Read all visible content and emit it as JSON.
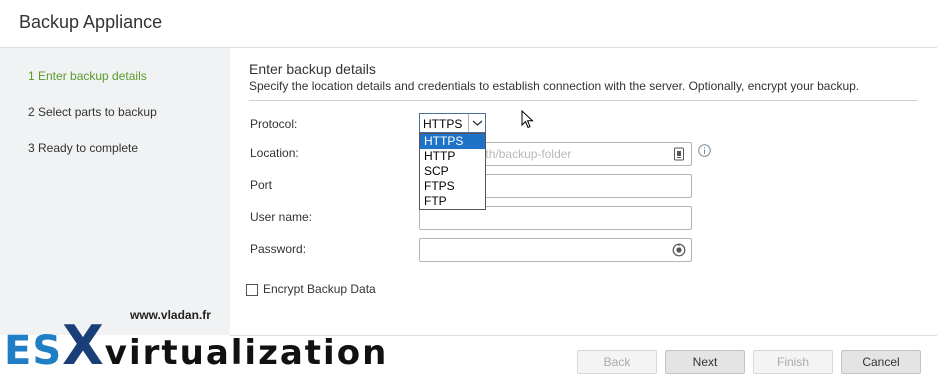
{
  "window": {
    "title": "Backup Appliance"
  },
  "sidebar": {
    "steps": [
      {
        "label": "1 Enter backup details",
        "active": true
      },
      {
        "label": "2 Select parts to backup",
        "active": false
      },
      {
        "label": "3 Ready to complete",
        "active": false
      }
    ]
  },
  "main": {
    "heading": "Enter backup details",
    "subheading": "Specify the location details and credentials to establish connection with the server. Optionally, encrypt your backup.",
    "protocol": {
      "label": "Protocol:",
      "selected": "HTTPS",
      "options": [
        "HTTPS",
        "HTTP",
        "SCP",
        "FTPS",
        "FTP"
      ]
    },
    "location": {
      "label": "Location:",
      "placeholder": "address/path/backup-folder",
      "value": ""
    },
    "port": {
      "label": "Port",
      "value": ""
    },
    "username": {
      "label": "User name:",
      "value": ""
    },
    "password": {
      "label": "Password:",
      "value": ""
    },
    "encrypt": {
      "label": "Encrypt Backup Data",
      "checked": false
    }
  },
  "footer": {
    "back": "Back",
    "next": "Next",
    "finish": "Finish",
    "cancel": "Cancel"
  },
  "watermark": {
    "url": "www.vladan.fr",
    "brand_es": "ES",
    "brand_x": "X",
    "brand_rest": "virtualization"
  },
  "colors": {
    "active_step": "#5a9a2b",
    "selected_option": "#1e73c9",
    "sidebar_bg": "#f0f2f3",
    "brand_blue": "#1f7ec4"
  }
}
